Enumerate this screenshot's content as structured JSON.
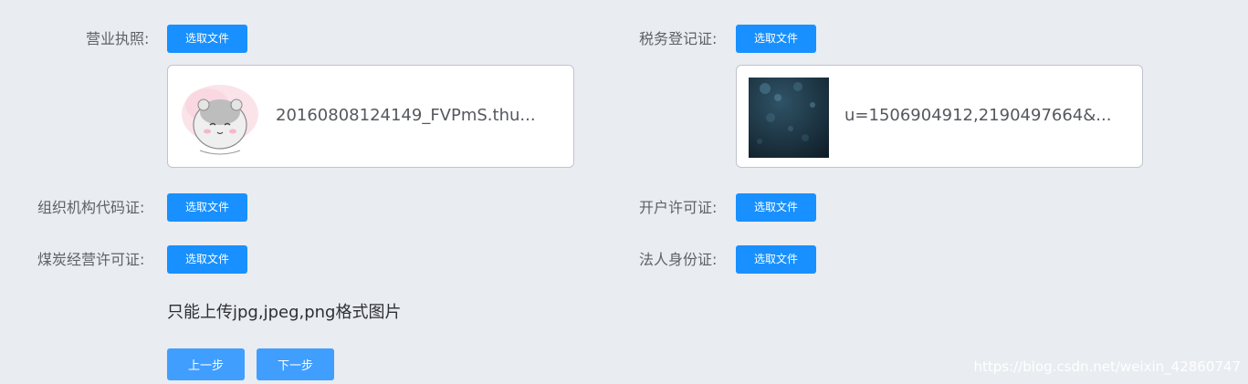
{
  "form": {
    "left": [
      {
        "label": "营业执照:",
        "button": "选取文件"
      },
      {
        "label": "组织机构代码证:",
        "button": "选取文件"
      },
      {
        "label": "煤炭经营许可证:",
        "button": "选取文件"
      }
    ],
    "right": [
      {
        "label": "税务登记证:",
        "button": "选取文件"
      },
      {
        "label": "开户许可证:",
        "button": "选取文件"
      },
      {
        "label": "法人身份证:",
        "button": "选取文件"
      }
    ]
  },
  "files": {
    "business_license": {
      "name": "20160808124149_FVPmS.thu...",
      "thumb_icon": "hamster-image"
    },
    "tax_registration": {
      "name": "u=1506904912,2190497664&...",
      "thumb_icon": "dark-bokeh-image"
    }
  },
  "hint": "只能上传jpg,jpeg,png格式图片",
  "nav": {
    "prev_label": "上一步",
    "next_label": "下一步"
  },
  "watermark": "https://blog.csdn.net/weixin_42860747",
  "colors": {
    "background": "#e9ecf1",
    "upload_button": "#1890ff",
    "step_button": "#409eff"
  }
}
